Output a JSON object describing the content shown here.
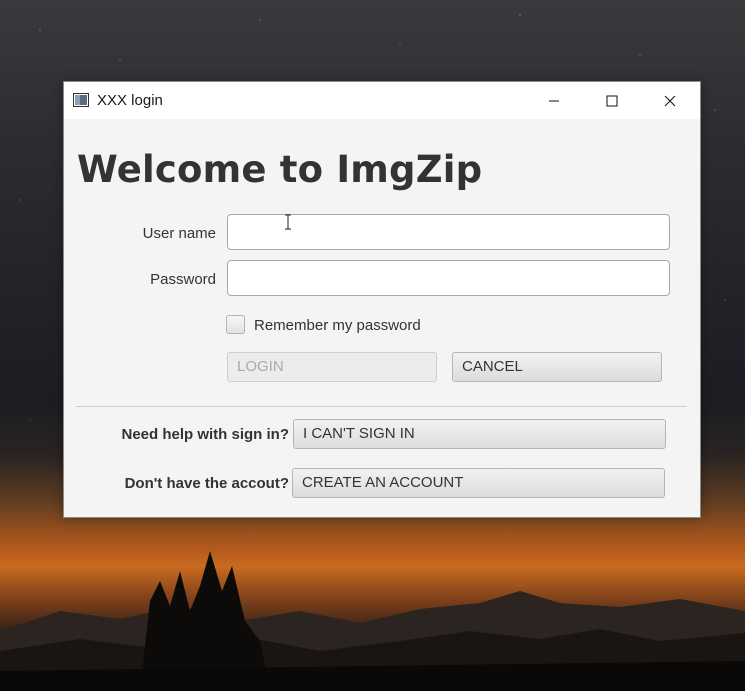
{
  "window": {
    "title": "XXX login",
    "controls": {
      "minimize": "minimize-icon",
      "maximize": "maximize-icon",
      "close": "close-icon"
    }
  },
  "login": {
    "heading": "Welcome to ImgZip",
    "username_label": "User name",
    "username_value": "",
    "password_label": "Password",
    "password_value": "",
    "remember_label": "Remember my password",
    "remember_checked": false,
    "login_button": "LOGIN",
    "login_enabled": false,
    "cancel_button": "CANCEL"
  },
  "help": {
    "signin_prompt": "Need help with sign in?",
    "signin_button": "I CAN'T SIGN IN",
    "account_prompt": "Don't have the accout?",
    "account_button": "CREATE AN ACCOUNT"
  },
  "colors": {
    "window_bg": "#f4f4f4",
    "titlebar_bg": "#ffffff",
    "text": "#333333",
    "disabled_text": "#a9a9a9"
  }
}
